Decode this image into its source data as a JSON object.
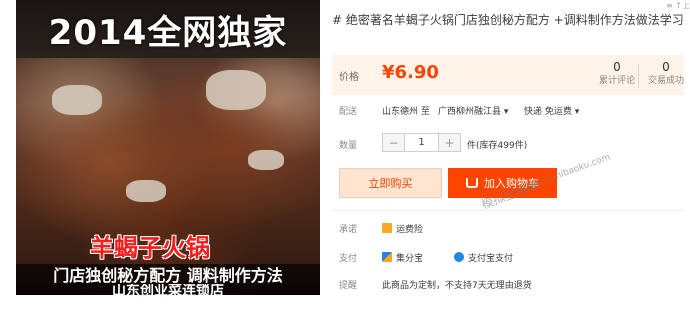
{
  "product_image": {
    "headline": "2014全网独家",
    "dish_name": "羊蝎子火锅",
    "caption_1": "门店独创秘方配方  调料制作方法",
    "caption_2": "山东创业菜连锁店"
  },
  "title": "# 绝密著名羊蝎子火锅门店独创秘方配方 +调料制作方法做法学习",
  "price": {
    "label": "价格",
    "value": "¥6.90",
    "color": "#ff4400"
  },
  "stats": {
    "reviews_count": "0",
    "reviews_label": "累计评论",
    "trades_count": "0",
    "trades_label": "交易成功"
  },
  "shipping": {
    "label": "配送",
    "from": "山东德州 至",
    "to": "广西柳州融江县",
    "express": "快递 免运费"
  },
  "quantity": {
    "label": "数量",
    "minus": "−",
    "value": "1",
    "plus": "+",
    "stock": "件(库存499件)"
  },
  "buttons": {
    "buy_now": "立即购买",
    "add_to_cart": "加入购物车",
    "accent": "#ff4400"
  },
  "commitment": {
    "label": "承诺",
    "item": "运费险"
  },
  "payment": {
    "label": "支付",
    "method_1": "集分宝",
    "method_2": "支付宝支付"
  },
  "notice": {
    "label": "提醒",
    "text": "此商品为定制，不支持7天无理由退货"
  },
  "watermark": {
    "name": "模拟宝库网",
    "url": "www.xunibaoku.com"
  },
  "corner_mark": "≡ ↑上"
}
